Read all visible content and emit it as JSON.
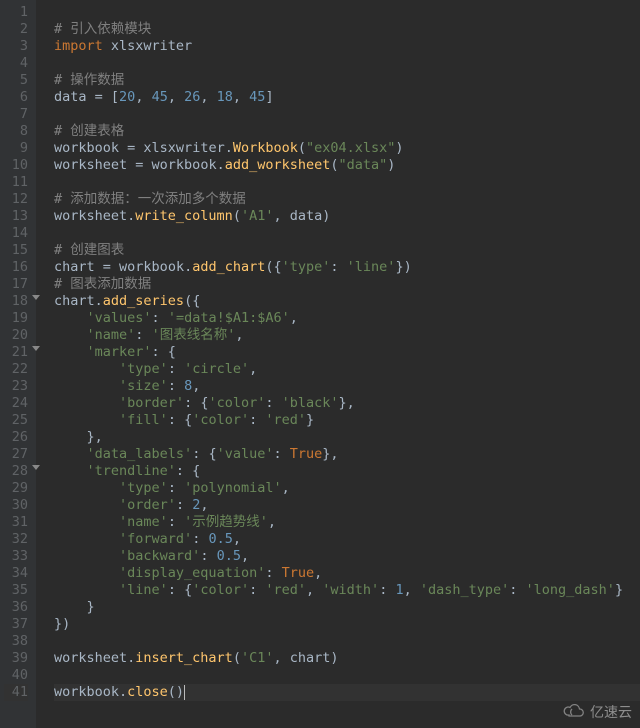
{
  "editor": {
    "cursor_line": 41,
    "lines": [
      {
        "n": 1,
        "tokens": []
      },
      {
        "n": 2,
        "tokens": [
          {
            "t": "# 引入依赖模块",
            "c": "comment"
          }
        ]
      },
      {
        "n": 3,
        "tokens": [
          {
            "t": "import ",
            "c": "keyword"
          },
          {
            "t": "xlsxwriter",
            "c": "ident"
          }
        ]
      },
      {
        "n": 4,
        "tokens": []
      },
      {
        "n": 5,
        "tokens": [
          {
            "t": "# 操作数据",
            "c": "comment"
          }
        ]
      },
      {
        "n": 6,
        "tokens": [
          {
            "t": "data ",
            "c": "ident"
          },
          {
            "t": "= ",
            "c": "ident"
          },
          {
            "t": "[",
            "c": "ident"
          },
          {
            "t": "20",
            "c": "number"
          },
          {
            "t": ", ",
            "c": "ident"
          },
          {
            "t": "45",
            "c": "number"
          },
          {
            "t": ", ",
            "c": "ident"
          },
          {
            "t": "26",
            "c": "number"
          },
          {
            "t": ", ",
            "c": "ident"
          },
          {
            "t": "18",
            "c": "number"
          },
          {
            "t": ", ",
            "c": "ident"
          },
          {
            "t": "45",
            "c": "number"
          },
          {
            "t": "]",
            "c": "ident"
          }
        ]
      },
      {
        "n": 7,
        "tokens": []
      },
      {
        "n": 8,
        "tokens": [
          {
            "t": "# 创建表格",
            "c": "comment"
          }
        ]
      },
      {
        "n": 9,
        "tokens": [
          {
            "t": "workbook ",
            "c": "ident"
          },
          {
            "t": "= ",
            "c": "ident"
          },
          {
            "t": "xlsxwriter.",
            "c": "ident"
          },
          {
            "t": "Workbook",
            "c": "func"
          },
          {
            "t": "(",
            "c": "ident"
          },
          {
            "t": "\"ex04.xlsx\"",
            "c": "string"
          },
          {
            "t": ")",
            "c": "ident"
          }
        ]
      },
      {
        "n": 10,
        "tokens": [
          {
            "t": "worksheet ",
            "c": "ident"
          },
          {
            "t": "= ",
            "c": "ident"
          },
          {
            "t": "workbook.",
            "c": "ident"
          },
          {
            "t": "add_worksheet",
            "c": "func"
          },
          {
            "t": "(",
            "c": "ident"
          },
          {
            "t": "\"data\"",
            "c": "string"
          },
          {
            "t": ")",
            "c": "ident"
          }
        ]
      },
      {
        "n": 11,
        "tokens": []
      },
      {
        "n": 12,
        "tokens": [
          {
            "t": "# 添加数据：一次添加多个数据",
            "c": "comment"
          }
        ]
      },
      {
        "n": 13,
        "tokens": [
          {
            "t": "worksheet.",
            "c": "ident"
          },
          {
            "t": "write_column",
            "c": "func"
          },
          {
            "t": "(",
            "c": "ident"
          },
          {
            "t": "'A1'",
            "c": "string"
          },
          {
            "t": ", data)",
            "c": "ident"
          }
        ]
      },
      {
        "n": 14,
        "tokens": []
      },
      {
        "n": 15,
        "tokens": [
          {
            "t": "# 创建图表",
            "c": "comment"
          }
        ]
      },
      {
        "n": 16,
        "tokens": [
          {
            "t": "chart ",
            "c": "ident"
          },
          {
            "t": "= ",
            "c": "ident"
          },
          {
            "t": "workbook.",
            "c": "ident"
          },
          {
            "t": "add_chart",
            "c": "func"
          },
          {
            "t": "({",
            "c": "ident"
          },
          {
            "t": "'type'",
            "c": "string"
          },
          {
            "t": ": ",
            "c": "ident"
          },
          {
            "t": "'line'",
            "c": "string"
          },
          {
            "t": "})",
            "c": "ident"
          }
        ]
      },
      {
        "n": 17,
        "tokens": [
          {
            "t": "# 图表添加数据",
            "c": "comment"
          }
        ]
      },
      {
        "n": 18,
        "fold": true,
        "tokens": [
          {
            "t": "chart.",
            "c": "ident"
          },
          {
            "t": "add_series",
            "c": "func"
          },
          {
            "t": "({",
            "c": "ident"
          }
        ]
      },
      {
        "n": 19,
        "tokens": [
          {
            "t": "    ",
            "c": ""
          },
          {
            "t": "'values'",
            "c": "string"
          },
          {
            "t": ": ",
            "c": "ident"
          },
          {
            "t": "'=data!$A1:$A6'",
            "c": "string"
          },
          {
            "t": ",",
            "c": "ident"
          }
        ]
      },
      {
        "n": 20,
        "tokens": [
          {
            "t": "    ",
            "c": ""
          },
          {
            "t": "'name'",
            "c": "string"
          },
          {
            "t": ": ",
            "c": "ident"
          },
          {
            "t": "'图表线名称'",
            "c": "string"
          },
          {
            "t": ",",
            "c": "ident"
          }
        ]
      },
      {
        "n": 21,
        "fold": true,
        "tokens": [
          {
            "t": "    ",
            "c": ""
          },
          {
            "t": "'marker'",
            "c": "string"
          },
          {
            "t": ": {",
            "c": "ident"
          }
        ]
      },
      {
        "n": 22,
        "tokens": [
          {
            "t": "        ",
            "c": ""
          },
          {
            "t": "'type'",
            "c": "string"
          },
          {
            "t": ": ",
            "c": "ident"
          },
          {
            "t": "'circle'",
            "c": "string"
          },
          {
            "t": ",",
            "c": "ident"
          }
        ]
      },
      {
        "n": 23,
        "tokens": [
          {
            "t": "        ",
            "c": ""
          },
          {
            "t": "'size'",
            "c": "string"
          },
          {
            "t": ": ",
            "c": "ident"
          },
          {
            "t": "8",
            "c": "number"
          },
          {
            "t": ",",
            "c": "ident"
          }
        ]
      },
      {
        "n": 24,
        "tokens": [
          {
            "t": "        ",
            "c": ""
          },
          {
            "t": "'border'",
            "c": "string"
          },
          {
            "t": ": {",
            "c": "ident"
          },
          {
            "t": "'color'",
            "c": "string"
          },
          {
            "t": ": ",
            "c": "ident"
          },
          {
            "t": "'black'",
            "c": "string"
          },
          {
            "t": "},",
            "c": "ident"
          }
        ]
      },
      {
        "n": 25,
        "tokens": [
          {
            "t": "        ",
            "c": ""
          },
          {
            "t": "'fill'",
            "c": "string"
          },
          {
            "t": ": {",
            "c": "ident"
          },
          {
            "t": "'color'",
            "c": "string"
          },
          {
            "t": ": ",
            "c": "ident"
          },
          {
            "t": "'red'",
            "c": "string"
          },
          {
            "t": "}",
            "c": "ident"
          }
        ]
      },
      {
        "n": 26,
        "tokens": [
          {
            "t": "    },",
            "c": "ident"
          }
        ]
      },
      {
        "n": 27,
        "tokens": [
          {
            "t": "    ",
            "c": ""
          },
          {
            "t": "'data_labels'",
            "c": "string"
          },
          {
            "t": ": {",
            "c": "ident"
          },
          {
            "t": "'value'",
            "c": "string"
          },
          {
            "t": ": ",
            "c": "ident"
          },
          {
            "t": "True",
            "c": "bool"
          },
          {
            "t": "},",
            "c": "ident"
          }
        ]
      },
      {
        "n": 28,
        "fold": true,
        "tokens": [
          {
            "t": "    ",
            "c": ""
          },
          {
            "t": "'trendline'",
            "c": "string"
          },
          {
            "t": ": {",
            "c": "ident"
          }
        ]
      },
      {
        "n": 29,
        "tokens": [
          {
            "t": "        ",
            "c": ""
          },
          {
            "t": "'type'",
            "c": "string"
          },
          {
            "t": ": ",
            "c": "ident"
          },
          {
            "t": "'polynomial'",
            "c": "string"
          },
          {
            "t": ",",
            "c": "ident"
          }
        ]
      },
      {
        "n": 30,
        "tokens": [
          {
            "t": "        ",
            "c": ""
          },
          {
            "t": "'order'",
            "c": "string"
          },
          {
            "t": ": ",
            "c": "ident"
          },
          {
            "t": "2",
            "c": "number"
          },
          {
            "t": ",",
            "c": "ident"
          }
        ]
      },
      {
        "n": 31,
        "tokens": [
          {
            "t": "        ",
            "c": ""
          },
          {
            "t": "'name'",
            "c": "string"
          },
          {
            "t": ": ",
            "c": "ident"
          },
          {
            "t": "'示例趋势线'",
            "c": "string"
          },
          {
            "t": ",",
            "c": "ident"
          }
        ]
      },
      {
        "n": 32,
        "tokens": [
          {
            "t": "        ",
            "c": ""
          },
          {
            "t": "'forward'",
            "c": "string"
          },
          {
            "t": ": ",
            "c": "ident"
          },
          {
            "t": "0.5",
            "c": "number"
          },
          {
            "t": ",",
            "c": "ident"
          }
        ]
      },
      {
        "n": 33,
        "tokens": [
          {
            "t": "        ",
            "c": ""
          },
          {
            "t": "'backward'",
            "c": "string"
          },
          {
            "t": ": ",
            "c": "ident"
          },
          {
            "t": "0.5",
            "c": "number"
          },
          {
            "t": ",",
            "c": "ident"
          }
        ]
      },
      {
        "n": 34,
        "tokens": [
          {
            "t": "        ",
            "c": ""
          },
          {
            "t": "'display_equation'",
            "c": "string"
          },
          {
            "t": ": ",
            "c": "ident"
          },
          {
            "t": "True",
            "c": "bool"
          },
          {
            "t": ",",
            "c": "ident"
          }
        ]
      },
      {
        "n": 35,
        "tokens": [
          {
            "t": "        ",
            "c": ""
          },
          {
            "t": "'line'",
            "c": "string"
          },
          {
            "t": ": {",
            "c": "ident"
          },
          {
            "t": "'color'",
            "c": "string"
          },
          {
            "t": ": ",
            "c": "ident"
          },
          {
            "t": "'red'",
            "c": "string"
          },
          {
            "t": ", ",
            "c": "ident"
          },
          {
            "t": "'width'",
            "c": "string"
          },
          {
            "t": ": ",
            "c": "ident"
          },
          {
            "t": "1",
            "c": "number"
          },
          {
            "t": ", ",
            "c": "ident"
          },
          {
            "t": "'dash_type'",
            "c": "string"
          },
          {
            "t": ": ",
            "c": "ident"
          },
          {
            "t": "'long_dash'",
            "c": "string"
          },
          {
            "t": "}",
            "c": "ident"
          }
        ]
      },
      {
        "n": 36,
        "tokens": [
          {
            "t": "    }",
            "c": "ident"
          }
        ]
      },
      {
        "n": 37,
        "tokens": [
          {
            "t": "})",
            "c": "ident"
          }
        ]
      },
      {
        "n": 38,
        "tokens": []
      },
      {
        "n": 39,
        "tokens": [
          {
            "t": "worksheet.",
            "c": "ident"
          },
          {
            "t": "insert_chart",
            "c": "func"
          },
          {
            "t": "(",
            "c": "ident"
          },
          {
            "t": "'C1'",
            "c": "string"
          },
          {
            "t": ", chart)",
            "c": "ident"
          }
        ]
      },
      {
        "n": 40,
        "tokens": []
      },
      {
        "n": 41,
        "tokens": [
          {
            "t": "workbook.",
            "c": "ident"
          },
          {
            "t": "close",
            "c": "func"
          },
          {
            "t": "()",
            "c": "ident"
          }
        ]
      }
    ]
  },
  "watermark": {
    "label": "亿速云"
  }
}
